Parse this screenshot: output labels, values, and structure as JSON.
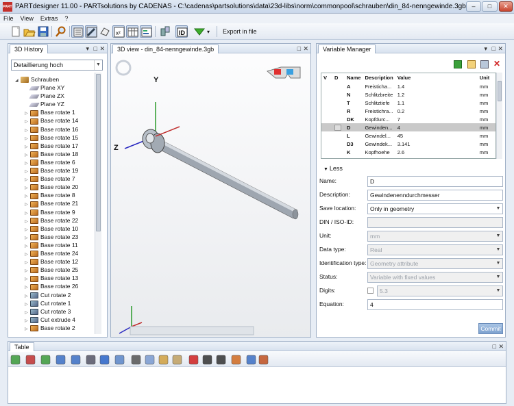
{
  "window": {
    "app_icon": "PART",
    "title": "PARTdesigner 11.00 - PARTsolutions by CADENAS - C:\\cadenas\\partsolutions\\data\\23d-libs\\norm\\commonpool\\schrauben\\din_84-nenngewinde.3gb",
    "min": "–",
    "max": "□",
    "close": "✕"
  },
  "menu": [
    "File",
    "View",
    "Extras",
    "?"
  ],
  "toolbar": {
    "export_label": "Export in file",
    "dropdown_arrow": "▾"
  },
  "history": {
    "tab": "3D History",
    "combo_value": "Detaillierung hoch",
    "root": "Schrauben",
    "items": [
      {
        "type": "plane",
        "label": "Plane XY"
      },
      {
        "type": "plane",
        "label": "Plane ZX"
      },
      {
        "type": "plane",
        "label": "Plane YZ"
      },
      {
        "type": "cube",
        "label": "Base rotate 1"
      },
      {
        "type": "cube",
        "label": "Base rotate 14"
      },
      {
        "type": "cube",
        "label": "Base rotate 16"
      },
      {
        "type": "cube",
        "label": "Base rotate 15"
      },
      {
        "type": "cube",
        "label": "Base rotate 17"
      },
      {
        "type": "cube",
        "label": "Base rotate 18"
      },
      {
        "type": "cube",
        "label": "Base rotate 6"
      },
      {
        "type": "cube",
        "label": "Base rotate 19"
      },
      {
        "type": "cube",
        "label": "Base rotate 7"
      },
      {
        "type": "cube",
        "label": "Base rotate 20"
      },
      {
        "type": "cube",
        "label": "Base rotate 8"
      },
      {
        "type": "cube",
        "label": "Base rotate 21"
      },
      {
        "type": "cube",
        "label": "Base rotate 9"
      },
      {
        "type": "cube",
        "label": "Base rotate 22"
      },
      {
        "type": "cube",
        "label": "Base rotate 10"
      },
      {
        "type": "cube",
        "label": "Base rotate 23"
      },
      {
        "type": "cube",
        "label": "Base rotate 11"
      },
      {
        "type": "cube",
        "label": "Base rotate 24"
      },
      {
        "type": "cube",
        "label": "Base rotate 12"
      },
      {
        "type": "cube",
        "label": "Base rotate 25"
      },
      {
        "type": "cube",
        "label": "Base rotate 13"
      },
      {
        "type": "cube",
        "label": "Base rotate 26"
      },
      {
        "type": "cut",
        "label": "Cut rotate 2"
      },
      {
        "type": "cut",
        "label": "Cut rotate 1"
      },
      {
        "type": "cut",
        "label": "Cut rotate 3"
      },
      {
        "type": "cut",
        "label": "Cut extrude 4"
      },
      {
        "type": "cube",
        "label": "Base rotate 2"
      }
    ]
  },
  "view3d": {
    "tab": "3D view - din_84-nenngewinde.3gb",
    "axis_y": "Y",
    "axis_z": "Z"
  },
  "varman": {
    "tab": "Variable Manager",
    "columns": [
      "V",
      "D",
      "Name",
      "Description",
      "Value",
      "Unit"
    ],
    "rows": [
      {
        "name": "A",
        "desc": "Freistichа...",
        "value": "1.4",
        "unit": "mm"
      },
      {
        "name": "N",
        "desc": "Schlitzbreite",
        "value": "1.2",
        "unit": "mm"
      },
      {
        "name": "T",
        "desc": "Schlitztiefe",
        "value": "1.1",
        "unit": "mm"
      },
      {
        "name": "R",
        "desc": "Freistichra...",
        "value": "0.2",
        "unit": "mm"
      },
      {
        "name": "DK",
        "desc": "Kopfdurc...",
        "value": "7",
        "unit": "mm"
      },
      {
        "name": "D",
        "desc": "Gewinden...",
        "value": "4",
        "unit": "mm"
      },
      {
        "name": "L",
        "desc": "Gewindel...",
        "value": "45",
        "unit": "mm"
      },
      {
        "name": "D3",
        "desc": "Gewindek...",
        "value": "3.141",
        "unit": "mm"
      },
      {
        "name": "K",
        "desc": "Kopfhoehe",
        "value": "2.6",
        "unit": "mm"
      }
    ],
    "less": "Less",
    "fields": {
      "name_label": "Name:",
      "name_value": "D",
      "desc_label": "Description:",
      "desc_value": "Gewindenenndurchmesser",
      "save_label": "Save location:",
      "save_value": "Only in geometry",
      "din_label": "DIN / ISO-ID:",
      "din_value": "",
      "unit_label": "Unit:",
      "unit_value": "mm",
      "dtype_label": "Data type:",
      "dtype_value": "Real",
      "idtype_label": "Identification type:",
      "idtype_value": "Geometry attribute",
      "status_label": "Status:",
      "status_value": "Variable with fixed values",
      "digits_label": "Digits:",
      "digits_value": "5.3",
      "eq_label": "Equation:",
      "eq_value": "4"
    },
    "commit": "Commit"
  },
  "table": {
    "tab": "Table"
  }
}
